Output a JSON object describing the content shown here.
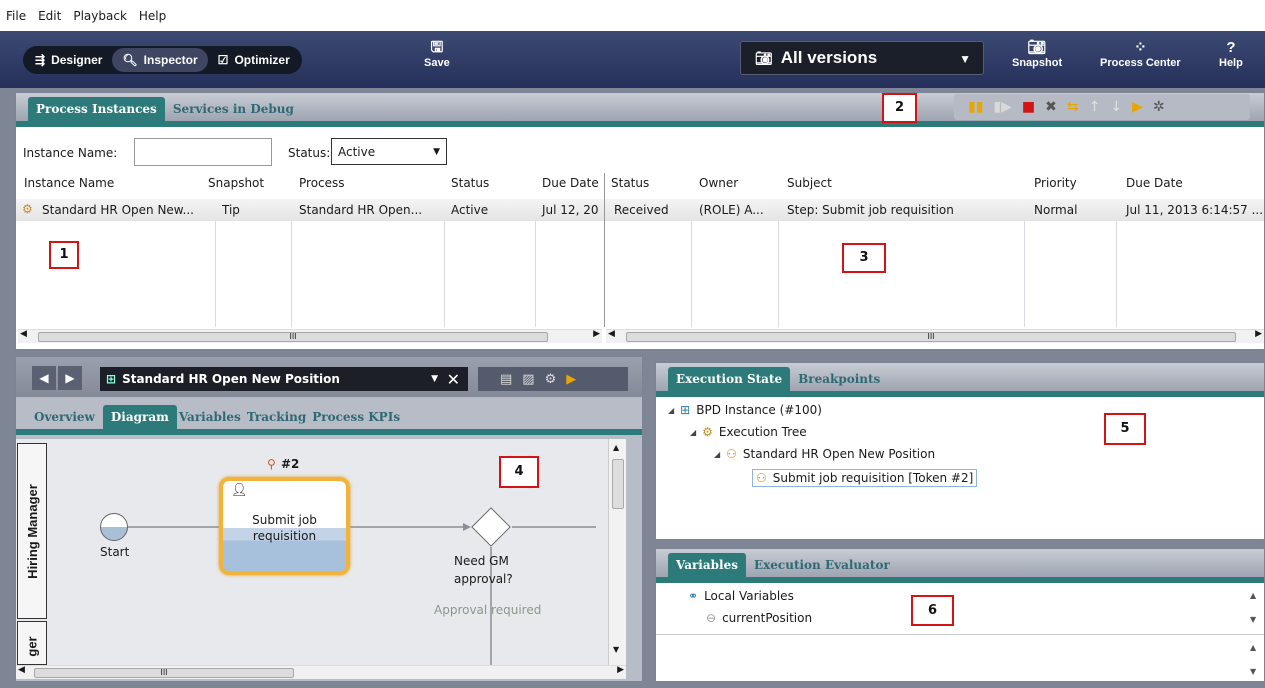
{
  "menu": [
    "File",
    "Edit",
    "Playback",
    "Help"
  ],
  "modes": {
    "designer": "Designer",
    "inspector": "Inspector",
    "optimizer": "Optimizer"
  },
  "toolbar": {
    "save": "Save",
    "versions": "All versions",
    "snapshot": "Snapshot",
    "process_center": "Process Center",
    "help": "Help"
  },
  "instances_panel": {
    "tabs": [
      "Process Instances",
      "Services in Debug"
    ],
    "filter_name_label": "Instance Name:",
    "filter_status_label": "Status:",
    "filter_status_value": "Active",
    "left_columns": [
      "Instance Name",
      "Snapshot",
      "Process",
      "Status",
      "Due Date"
    ],
    "left_row": [
      "Standard HR Open New...",
      "Tip",
      "Standard HR Open...",
      "Active",
      "Jul 12, 20"
    ],
    "right_columns": [
      "Status",
      "Owner",
      "Subject",
      "Priority",
      "Due Date"
    ],
    "right_row": [
      "Received",
      "(ROLE) A...",
      "Step: Submit job requisition",
      "Normal",
      "Jul 11, 2013 6:14:57 ..."
    ],
    "scroll_mark": "III"
  },
  "markers": [
    "1",
    "2",
    "3",
    "4",
    "5",
    "6"
  ],
  "diagram_panel": {
    "title": "Standard HR Open New Position",
    "tabs": [
      "Overview",
      "Diagram",
      "Variables",
      "Tracking",
      "Process KPIs"
    ],
    "lanes": [
      "Hiring Manager",
      "ger"
    ],
    "start_label": "Start",
    "activity_label": [
      "Submit job",
      "requisition"
    ],
    "token_label": "#2",
    "gateway_label": [
      "Need GM",
      "approval?"
    ],
    "flow_label": "Approval required",
    "scroll_mark": "III"
  },
  "execution_panel": {
    "tabs": [
      "Execution State",
      "Breakpoints"
    ],
    "tree": [
      "BPD Instance (#100)",
      "Execution Tree",
      "Standard HR Open New Position",
      "Submit job requisition [Token #2]"
    ]
  },
  "variables_panel": {
    "tabs": [
      "Variables",
      "Execution Evaluator"
    ],
    "items": [
      "Local Variables",
      "currentPosition"
    ]
  }
}
